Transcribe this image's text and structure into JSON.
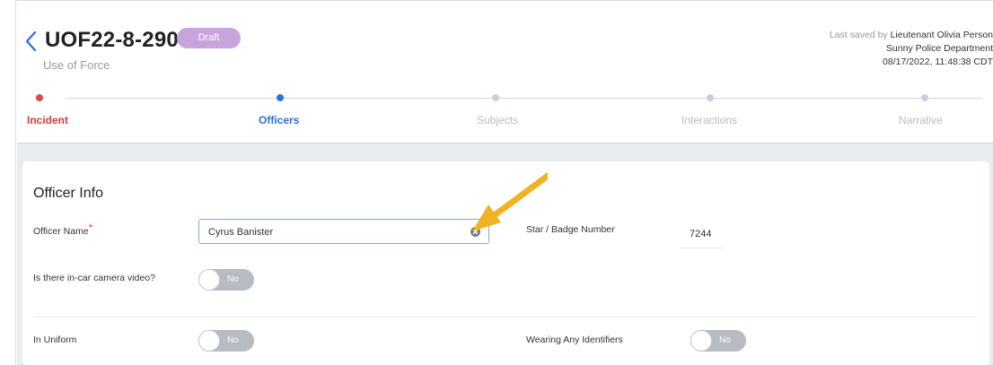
{
  "header": {
    "case_id": "UOF22-8-290",
    "status_badge": "Draft",
    "case_type": "Use of Force",
    "last_saved_prefix": "Last saved by",
    "last_saved_by": "Lieutenant Olivia Person",
    "department": "Sunny Police Department",
    "timestamp": "08/17/2022, 11:48:38 CDT"
  },
  "steps": [
    {
      "label": "Incident",
      "state": "error"
    },
    {
      "label": "Officers",
      "state": "active"
    },
    {
      "label": "Subjects",
      "state": "pending"
    },
    {
      "label": "Interactions",
      "state": "pending"
    },
    {
      "label": "Narrative",
      "state": "pending"
    }
  ],
  "officer_info": {
    "title": "Officer Info",
    "officer_name_label": "Officer Name",
    "required_mark": "*",
    "officer_name_value": "Cyrus Banister",
    "badge_label": "Star / Badge Number",
    "badge_value": "7244",
    "camera_label": "Is there in-car camera video?",
    "camera_toggle": "No",
    "uniform_label": "In Uniform",
    "uniform_toggle": "No",
    "identifiers_label": "Wearing Any Identifiers",
    "identifiers_toggle": "No"
  },
  "colors": {
    "accent": "#2f6fe0",
    "error": "#e04848",
    "draft_badge": "#c7a4dc",
    "annotation_arrow": "#f0b323"
  }
}
